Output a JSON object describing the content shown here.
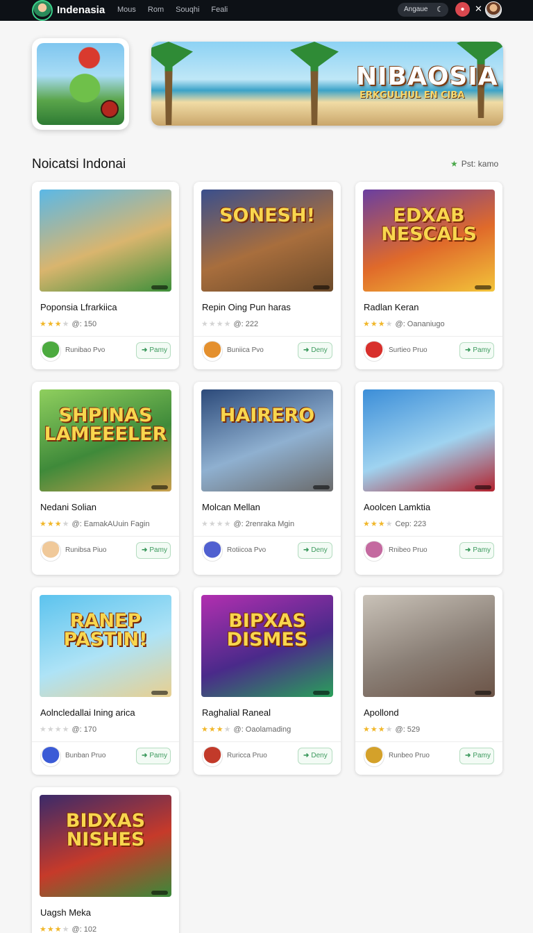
{
  "nav": {
    "brand": "Indenasia",
    "links": [
      "Mous",
      "Rom",
      "Souqhi",
      "Feali"
    ],
    "select_label": "Angaue",
    "moon_icon": "moon-icon",
    "notif_icon": "bell-icon",
    "close_icon": "close-icon"
  },
  "hero": {
    "title": "NIBAOSIA",
    "subtitle": "ERKGULHUL EN CIBA"
  },
  "section": {
    "title": "Noicatsi Indonai",
    "filter": "Pst: kamo"
  },
  "cards": [
    {
      "title": "Poponsia Lfrarkiica",
      "stars": 3,
      "meta": "@: 150",
      "author": "Runibao Pvo",
      "play": "Pamy",
      "img_title": "",
      "img_colors": [
        "#5bb8e6",
        "#d9b56e",
        "#3d8f3a"
      ],
      "avatar_color": "#4caa3f"
    },
    {
      "title": "Repin Oing Pun haras",
      "stars": 0,
      "meta": "@: 222",
      "author": "Buniica Pvo",
      "play": "Deny",
      "img_title": "SONESH!",
      "img_colors": [
        "#3a4f8c",
        "#a86e3d",
        "#6b4a2a"
      ],
      "avatar_color": "#e4902e"
    },
    {
      "title": "Radlan Keran",
      "stars": 3,
      "meta": "@: Oananiugo",
      "author": "Surtieo Pruo",
      "play": "Pamy",
      "img_title": "EDXAB NESCALS",
      "img_colors": [
        "#6a3fa0",
        "#e06a2a",
        "#f2c43a"
      ],
      "avatar_color": "#d8302c"
    },
    {
      "title": "Nedani Solian",
      "stars": 3,
      "meta": "@: EamakAUuin Fagin",
      "author": "Runibsa Piuo",
      "play": "Pamy",
      "img_title": "SHPINAS LAMEEELER",
      "img_colors": [
        "#8fcf5e",
        "#3f8a3a",
        "#c9a04e"
      ],
      "avatar_color": "#f0c99a"
    },
    {
      "title": "Molcan Mellan",
      "stars": 0,
      "meta": "@: 2renraka Mgin",
      "author": "Rotiicoa Pvo",
      "play": "Deny",
      "img_title": "HAIRERO",
      "img_colors": [
        "#2c4a7a",
        "#8fb0d0",
        "#6a6a6a"
      ],
      "avatar_color": "#5060d0"
    },
    {
      "title": "Aoolcen Lamktia",
      "stars": 3,
      "meta": "Cep: 223",
      "author": "Rnibeo Pruo",
      "play": "Pamy",
      "img_title": "",
      "img_colors": [
        "#3c8ed8",
        "#9fd3f0",
        "#b2222e"
      ],
      "avatar_color": "#c46aa0"
    },
    {
      "title": "Aolncledallai Ining arica",
      "stars": 0,
      "meta": "@: 170",
      "author": "Bunban Pruo",
      "play": "Pamy",
      "img_title": "RANEP PASTIN!",
      "img_colors": [
        "#5cc3ee",
        "#aee3f6",
        "#e8cf8f"
      ],
      "avatar_color": "#3b5bd6"
    },
    {
      "title": "Raghalial Raneal",
      "stars": 3,
      "meta": "@: Oaolamading",
      "author": "Ruricca Pruo",
      "play": "Deny",
      "img_title": "BIPXAS DISMES",
      "img_colors": [
        "#b22fb0",
        "#4a2a8a",
        "#2aa05a"
      ],
      "avatar_color": "#c23a2a"
    },
    {
      "title": "Apollond",
      "stars": 3,
      "meta": "@: 529",
      "author": "Runbeo Pruo",
      "play": "Pamy",
      "img_title": "",
      "img_colors": [
        "#c9c2b8",
        "#8a7f76",
        "#6b5346"
      ],
      "avatar_color": "#d4a12a"
    },
    {
      "title": "Uagsh Meka",
      "stars": 3,
      "meta": "@: 102",
      "author": "",
      "play": "",
      "img_title": "BIDXAS NISHES",
      "img_colors": [
        "#3a2a6a",
        "#c63a2a",
        "#3a8a3a"
      ],
      "avatar_color": "#999999"
    }
  ]
}
